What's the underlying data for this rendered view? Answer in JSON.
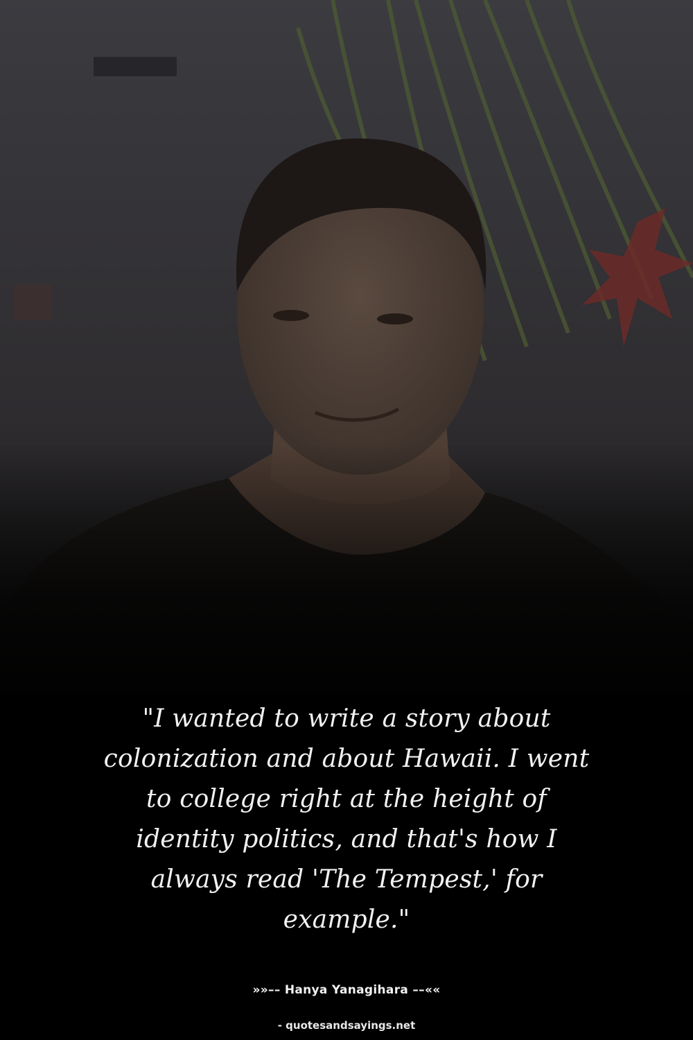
{
  "quote": {
    "text": "\"I wanted to write a story about colonization and about Hawaii. I went to college right at the height of identity politics, and that's how I always read 'The Tempest,' for example.\""
  },
  "author": {
    "line": "»»–– Hanya Yanagihara ––««"
  },
  "source": {
    "label": "- quotesandsayings.net"
  },
  "colors": {
    "background": "#000000",
    "text": "#f2f2f2"
  }
}
